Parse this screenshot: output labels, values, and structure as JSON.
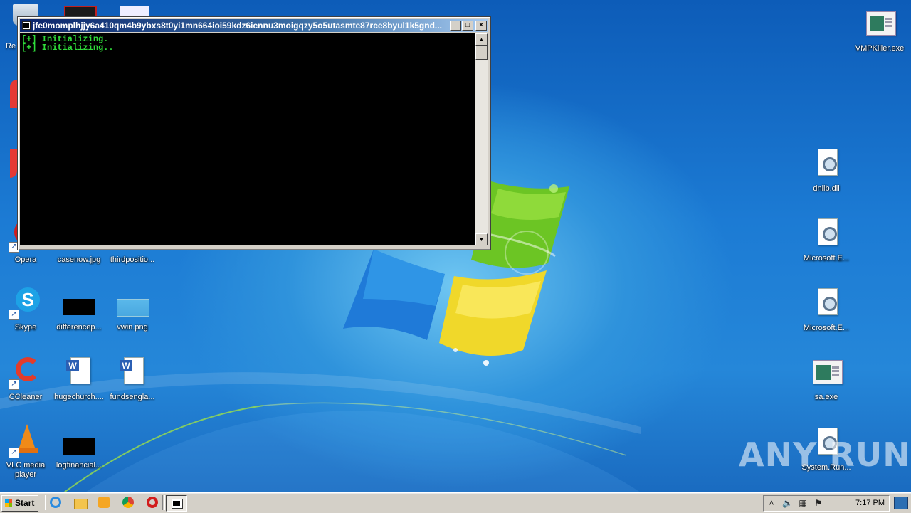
{
  "console": {
    "title": "jfe0momplhjjy6a410qm4b9ybxs8t0yi1mn664ioi59kdz6icnnu3moigqzy5o5utasmte87rce8byul1k5gnd...",
    "lines": [
      "[+] Initializing.",
      "[+] Initializing.."
    ],
    "minimize_label": "_",
    "maximize_label": "□",
    "close_label": "×",
    "scroll_up": "▲",
    "scroll_down": "▼"
  },
  "desktop_icons": [
    {
      "label": "Opera",
      "icon": "opera-icon",
      "shortcut": true
    },
    {
      "label": "casenow.jpg",
      "icon": "image-icon",
      "shortcut": false
    },
    {
      "label": "thirdpositio...",
      "icon": "document-icon",
      "shortcut": false
    },
    {
      "label": "Skype",
      "icon": "skype-icon",
      "shortcut": true
    },
    {
      "label": "differencep...",
      "icon": "image-icon",
      "shortcut": false
    },
    {
      "label": "vwin.png",
      "icon": "image-icon",
      "shortcut": false
    },
    {
      "label": "CCleaner",
      "icon": "ccleaner-icon",
      "shortcut": true
    },
    {
      "label": "hugechurch....",
      "icon": "word-document-icon",
      "shortcut": false
    },
    {
      "label": "fundsengla...",
      "icon": "word-document-icon",
      "shortcut": false
    },
    {
      "label": "VLC media player",
      "icon": "vlc-icon",
      "shortcut": true
    },
    {
      "label": "logfinancial...",
      "icon": "image-icon",
      "shortcut": false
    },
    {
      "label": "VMPKiller.exe",
      "icon": "exe-icon",
      "shortcut": false
    },
    {
      "label": "dnlib.dll",
      "icon": "dll-icon",
      "shortcut": false
    },
    {
      "label": "Microsoft.E...",
      "icon": "dll-icon",
      "shortcut": false
    },
    {
      "label": "Microsoft.E...",
      "icon": "dll-icon",
      "shortcut": false
    },
    {
      "label": "sa.exe",
      "icon": "exe-icon",
      "shortcut": false
    },
    {
      "label": "System.Run...",
      "icon": "dll-icon",
      "shortcut": false
    },
    {
      "label": "Re",
      "icon": "recycle-bin-icon",
      "shortcut": false
    }
  ],
  "taskbar": {
    "start_label": "Start",
    "clock": "7:17 PM",
    "quick_launch": [
      "ie-icon",
      "explorer-folder-icon",
      "media-player-icon",
      "chrome-icon",
      "opera-icon"
    ],
    "tray": [
      "chevron-up-icon",
      "speaker-icon",
      "network-icon",
      "action-center-flag-icon"
    ]
  },
  "watermark": "ANY RUN",
  "colors": {
    "console_text": "#2fdc3a",
    "title_gradient_start": "#0a246a",
    "desktop_blue": "#1c7bd4"
  }
}
